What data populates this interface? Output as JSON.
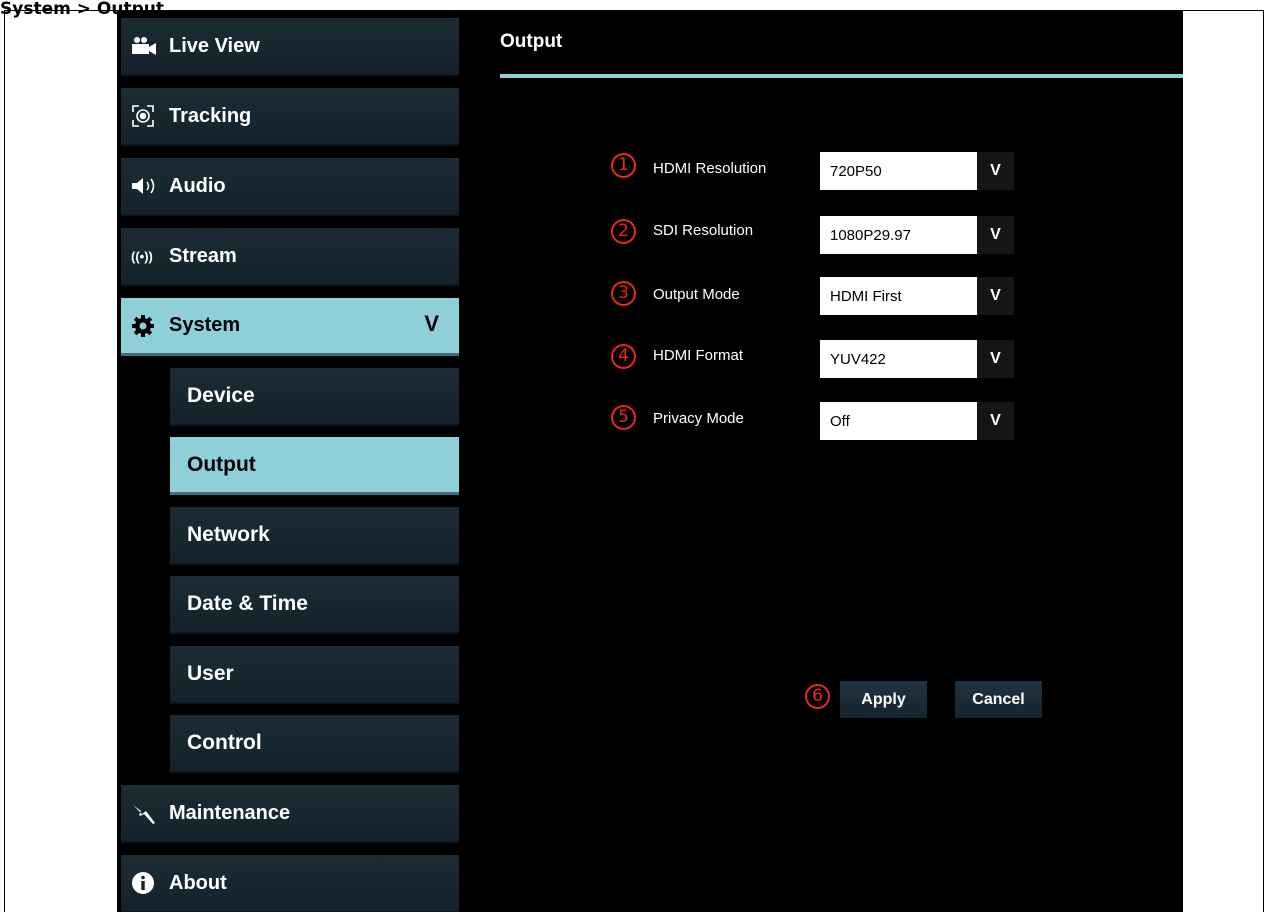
{
  "page_heading": "System > Output",
  "nav": {
    "live_view": "Live View",
    "tracking": "Tracking",
    "audio": "Audio",
    "stream": "Stream",
    "system": "System",
    "system_chevron": "V",
    "device": "Device",
    "output": "Output",
    "network": "Network",
    "date_time": "Date & Time",
    "user": "User",
    "control": "Control",
    "maintenance": "Maintenance",
    "about": "About"
  },
  "content": {
    "title": "Output",
    "fields": [
      {
        "number": "1",
        "label": "HDMI Resolution",
        "value": "720P50",
        "arrow": "V"
      },
      {
        "number": "2",
        "label": "SDI Resolution",
        "value": "1080P29.97",
        "arrow": "V"
      },
      {
        "number": "3",
        "label": "Output Mode",
        "value": "HDMI First",
        "arrow": "V"
      },
      {
        "number": "4",
        "label": "HDMI Format",
        "value": "YUV422",
        "arrow": "V"
      },
      {
        "number": "5",
        "label": "Privacy Mode",
        "value": "Off",
        "arrow": "V"
      }
    ],
    "apply_number": "6",
    "apply": "Apply",
    "cancel": "Cancel"
  },
  "colors": {
    "accent": "#8ecfd8",
    "annotation_red": "#e8281e",
    "background": "#000000",
    "nav_bg": "#1b2932"
  },
  "icons": {
    "live_view": "video-camera-icon",
    "tracking": "tracking-target-icon",
    "audio": "speaker-icon",
    "stream": "broadcast-icon",
    "system": "gear-icon",
    "maintenance": "wrench-icon",
    "about": "info-icon"
  }
}
